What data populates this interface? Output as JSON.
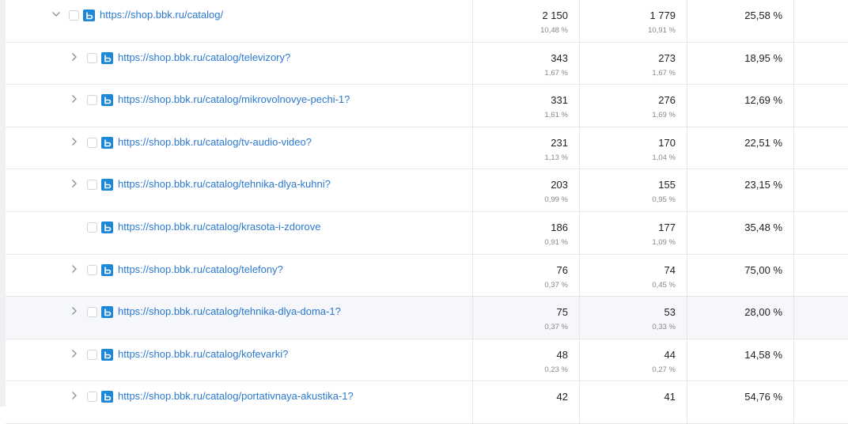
{
  "rows": [
    {
      "level": 0,
      "expand": "expanded",
      "url": "https://shop.bbk.ru/catalog/",
      "v1": "2 150",
      "p1": "10,48 %",
      "v2": "1 779",
      "p2": "10,91 %",
      "v3": "25,58 %"
    },
    {
      "level": 1,
      "expand": "collapsed",
      "url": "https://shop.bbk.ru/catalog/televizory?",
      "v1": "343",
      "p1": "1,67 %",
      "v2": "273",
      "p2": "1,67 %",
      "v3": "18,95 %"
    },
    {
      "level": 1,
      "expand": "collapsed",
      "url": "https://shop.bbk.ru/catalog/mikrovolnovye-pechi-1?",
      "v1": "331",
      "p1": "1,61 %",
      "v2": "276",
      "p2": "1,69 %",
      "v3": "12,69 %"
    },
    {
      "level": 1,
      "expand": "collapsed",
      "url": "https://shop.bbk.ru/catalog/tv-audio-video?",
      "v1": "231",
      "p1": "1,13 %",
      "v2": "170",
      "p2": "1,04 %",
      "v3": "22,51 %"
    },
    {
      "level": 1,
      "expand": "collapsed",
      "url": "https://shop.bbk.ru/catalog/tehnika-dlya-kuhni?",
      "v1": "203",
      "p1": "0,99 %",
      "v2": "155",
      "p2": "0,95 %",
      "v3": "23,15 %"
    },
    {
      "level": 1,
      "expand": "none",
      "url": "https://shop.bbk.ru/catalog/krasota-i-zdorove",
      "v1": "186",
      "p1": "0,91 %",
      "v2": "177",
      "p2": "1,09 %",
      "v3": "35,48 %"
    },
    {
      "level": 1,
      "expand": "collapsed",
      "url": "https://shop.bbk.ru/catalog/telefony?",
      "v1": "76",
      "p1": "0,37 %",
      "v2": "74",
      "p2": "0,45 %",
      "v3": "75,00 %"
    },
    {
      "level": 1,
      "expand": "collapsed",
      "url": "https://shop.bbk.ru/catalog/tehnika-dlya-doma-1?",
      "v1": "75",
      "p1": "0,37 %",
      "v2": "53",
      "p2": "0,33 %",
      "v3": "28,00 %",
      "hover": true
    },
    {
      "level": 1,
      "expand": "collapsed",
      "url": "https://shop.bbk.ru/catalog/kofevarki?",
      "v1": "48",
      "p1": "0,23 %",
      "v2": "44",
      "p2": "0,27 %",
      "v3": "14,58 %"
    },
    {
      "level": 1,
      "expand": "collapsed",
      "url": "https://shop.bbk.ru/catalog/portativnaya-akustika-1?",
      "v1": "42",
      "p1": "",
      "v2": "41",
      "p2": "",
      "v3": "54,76 %"
    }
  ],
  "icons": {
    "expanded": "chevron-down-icon",
    "collapsed": "chevron-right-icon",
    "favicon": "site-favicon-icon"
  },
  "colors": {
    "link": "#2a79cf",
    "favicon": "#1e88d8",
    "row_hover": "#f5f7fa"
  }
}
